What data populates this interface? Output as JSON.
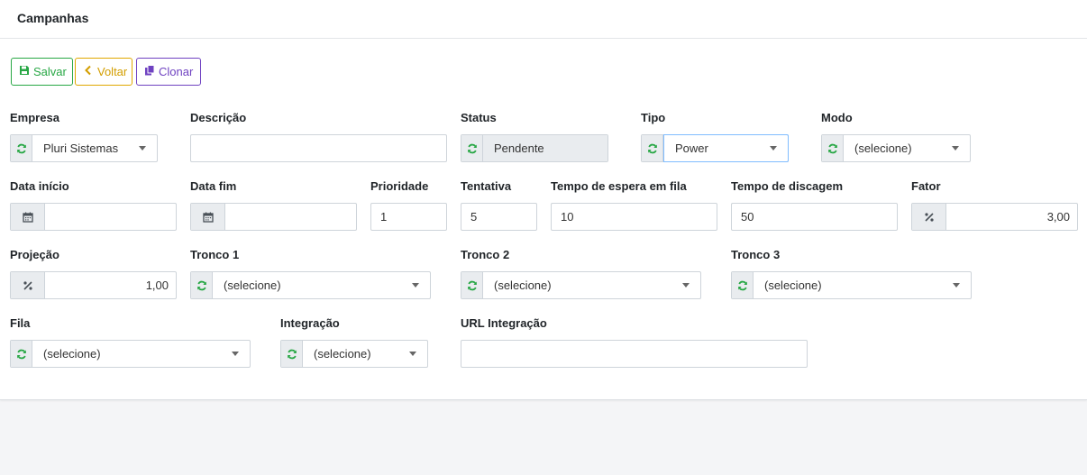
{
  "header": {
    "title": "Campanhas"
  },
  "toolbar": {
    "save_label": "Salvar",
    "back_label": "Voltar",
    "clone_label": "Clonar"
  },
  "colors": {
    "save": "#28a745",
    "back": "#d39e00",
    "clone": "#6f42c1",
    "refresh_icon": "#28a745"
  },
  "form": {
    "empresa": {
      "label": "Empresa",
      "value": "Pluri Sistemas"
    },
    "descricao": {
      "label": "Descrição",
      "value": ""
    },
    "status": {
      "label": "Status",
      "value": "Pendente"
    },
    "tipo": {
      "label": "Tipo",
      "value": "Power"
    },
    "modo": {
      "label": "Modo",
      "value": "(selecione)"
    },
    "data_inicio": {
      "label": "Data início",
      "value": ""
    },
    "data_fim": {
      "label": "Data fim",
      "value": ""
    },
    "prioridade": {
      "label": "Prioridade",
      "value": "1"
    },
    "tentativa": {
      "label": "Tentativa",
      "value": "5"
    },
    "tempo_espera": {
      "label": "Tempo de espera em fila",
      "value": "10"
    },
    "tempo_discagem": {
      "label": "Tempo de discagem",
      "value": "50"
    },
    "fator": {
      "label": "Fator",
      "value": "3,00"
    },
    "projecao": {
      "label": "Projeção",
      "value": "1,00"
    },
    "tronco1": {
      "label": "Tronco 1",
      "value": "(selecione)"
    },
    "tronco2": {
      "label": "Tronco 2",
      "value": "(selecione)"
    },
    "tronco3": {
      "label": "Tronco 3",
      "value": "(selecione)"
    },
    "fila": {
      "label": "Fila",
      "value": "(selecione)"
    },
    "integracao": {
      "label": "Integração",
      "value": "(selecione)"
    },
    "url_integracao": {
      "label": "URL Integração",
      "value": ""
    }
  }
}
